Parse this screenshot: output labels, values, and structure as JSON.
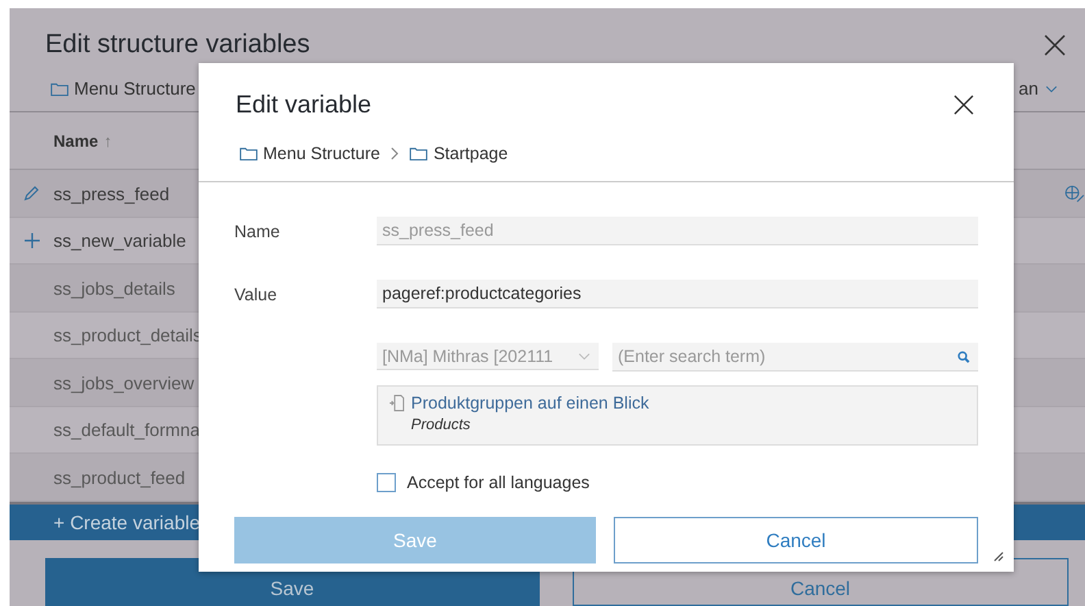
{
  "background": {
    "title": "Edit structure variables",
    "breadcrumb": "Menu Structure",
    "language_selector": "an",
    "column": {
      "label": "Name",
      "sort_mark": "↑"
    },
    "rows": [
      {
        "name": "ss_press_feed",
        "kind": "edited",
        "translation": true
      },
      {
        "name": "ss_new_variable",
        "kind": "new",
        "translation": false
      },
      {
        "name": "ss_jobs_details",
        "kind": "plain",
        "translation": false
      },
      {
        "name": "ss_product_details",
        "kind": "plain",
        "translation": false
      },
      {
        "name": "ss_jobs_overview",
        "kind": "plain",
        "translation": false
      },
      {
        "name": "ss_default_formna",
        "kind": "plain",
        "translation": false
      },
      {
        "name": "ss_product_feed",
        "kind": "plain",
        "translation": false
      }
    ],
    "create_button": "+ Create variable",
    "buttons": [
      {
        "label": "Save",
        "kind": "primary"
      },
      {
        "label": "Cancel",
        "kind": "secondary"
      }
    ]
  },
  "dialog": {
    "title": "Edit variable",
    "breadcrumb": [
      "Menu Structure",
      "Startpage"
    ],
    "fields": [
      {
        "label": "Name",
        "value": "ss_press_feed",
        "disabled": true
      },
      {
        "label": "Value",
        "value": "pageref:productcategories",
        "disabled": false
      }
    ],
    "project_select": {
      "value": "[NMa] Mithras [202111"
    },
    "search": {
      "placeholder": "(Enter search term)"
    },
    "results": [
      {
        "title": "Produktgruppen auf einen Blick",
        "subtitle": "Products"
      }
    ],
    "checkbox": {
      "label": "Accept for all languages",
      "checked": false
    },
    "buttons": [
      {
        "label": "Save",
        "kind": "primary",
        "disabled": true
      },
      {
        "label": "Cancel",
        "kind": "secondary",
        "disabled": false
      }
    ]
  }
}
